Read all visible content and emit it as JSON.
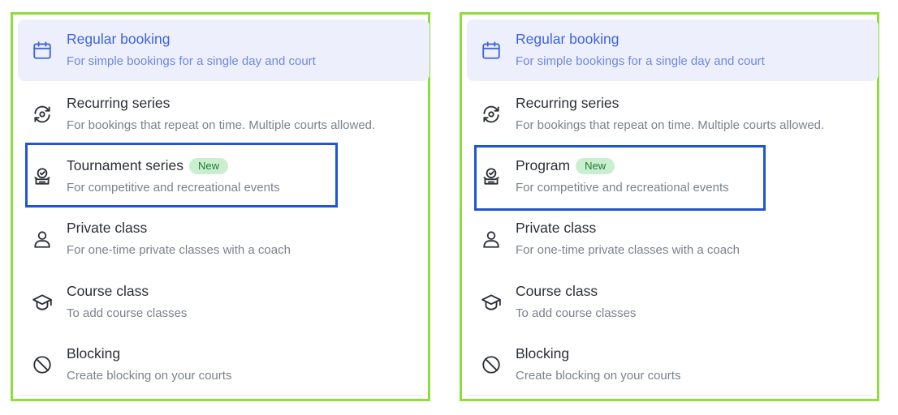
{
  "colors": {
    "panel_border": "#8fdc3a",
    "highlight_border": "#1f55d9",
    "selected_bg": "#edf0fc",
    "selected_text": "#3f63e0",
    "badge_bg": "#c9efcf",
    "badge_text": "#1f7a36"
  },
  "left_panel": {
    "items": [
      {
        "title": "Regular booking",
        "desc": "For simple bookings for a single day and court",
        "icon": "calendar-icon",
        "selected": true
      },
      {
        "title": "Recurring series",
        "desc": "For bookings that repeat on time. Multiple courts allowed.",
        "icon": "refresh-icon"
      },
      {
        "title": "Tournament series",
        "badge": "New",
        "desc": "For competitive and recreational events",
        "icon": "trophy-icon",
        "highlighted": true
      },
      {
        "title": "Private class",
        "desc": "For one-time private classes with a coach",
        "icon": "user-icon"
      },
      {
        "title": "Course class",
        "desc": "To add course classes",
        "icon": "graduation-cap-icon"
      },
      {
        "title": "Blocking",
        "desc": "Create blocking on your courts",
        "icon": "block-icon"
      }
    ]
  },
  "right_panel": {
    "items": [
      {
        "title": "Regular booking",
        "desc": "For simple bookings for a single day and court",
        "icon": "calendar-icon",
        "selected": true
      },
      {
        "title": "Recurring series",
        "desc": "For bookings that repeat on time. Multiple courts allowed.",
        "icon": "refresh-icon"
      },
      {
        "title": "Program",
        "badge": "New",
        "desc": "For competitive and recreational events",
        "icon": "trophy-icon",
        "highlighted": true
      },
      {
        "title": "Private class",
        "desc": "For one-time private classes with a coach",
        "icon": "user-icon"
      },
      {
        "title": "Course class",
        "desc": "To add course classes",
        "icon": "graduation-cap-icon"
      },
      {
        "title": "Blocking",
        "desc": "Create blocking on your courts",
        "icon": "block-icon"
      }
    ]
  }
}
